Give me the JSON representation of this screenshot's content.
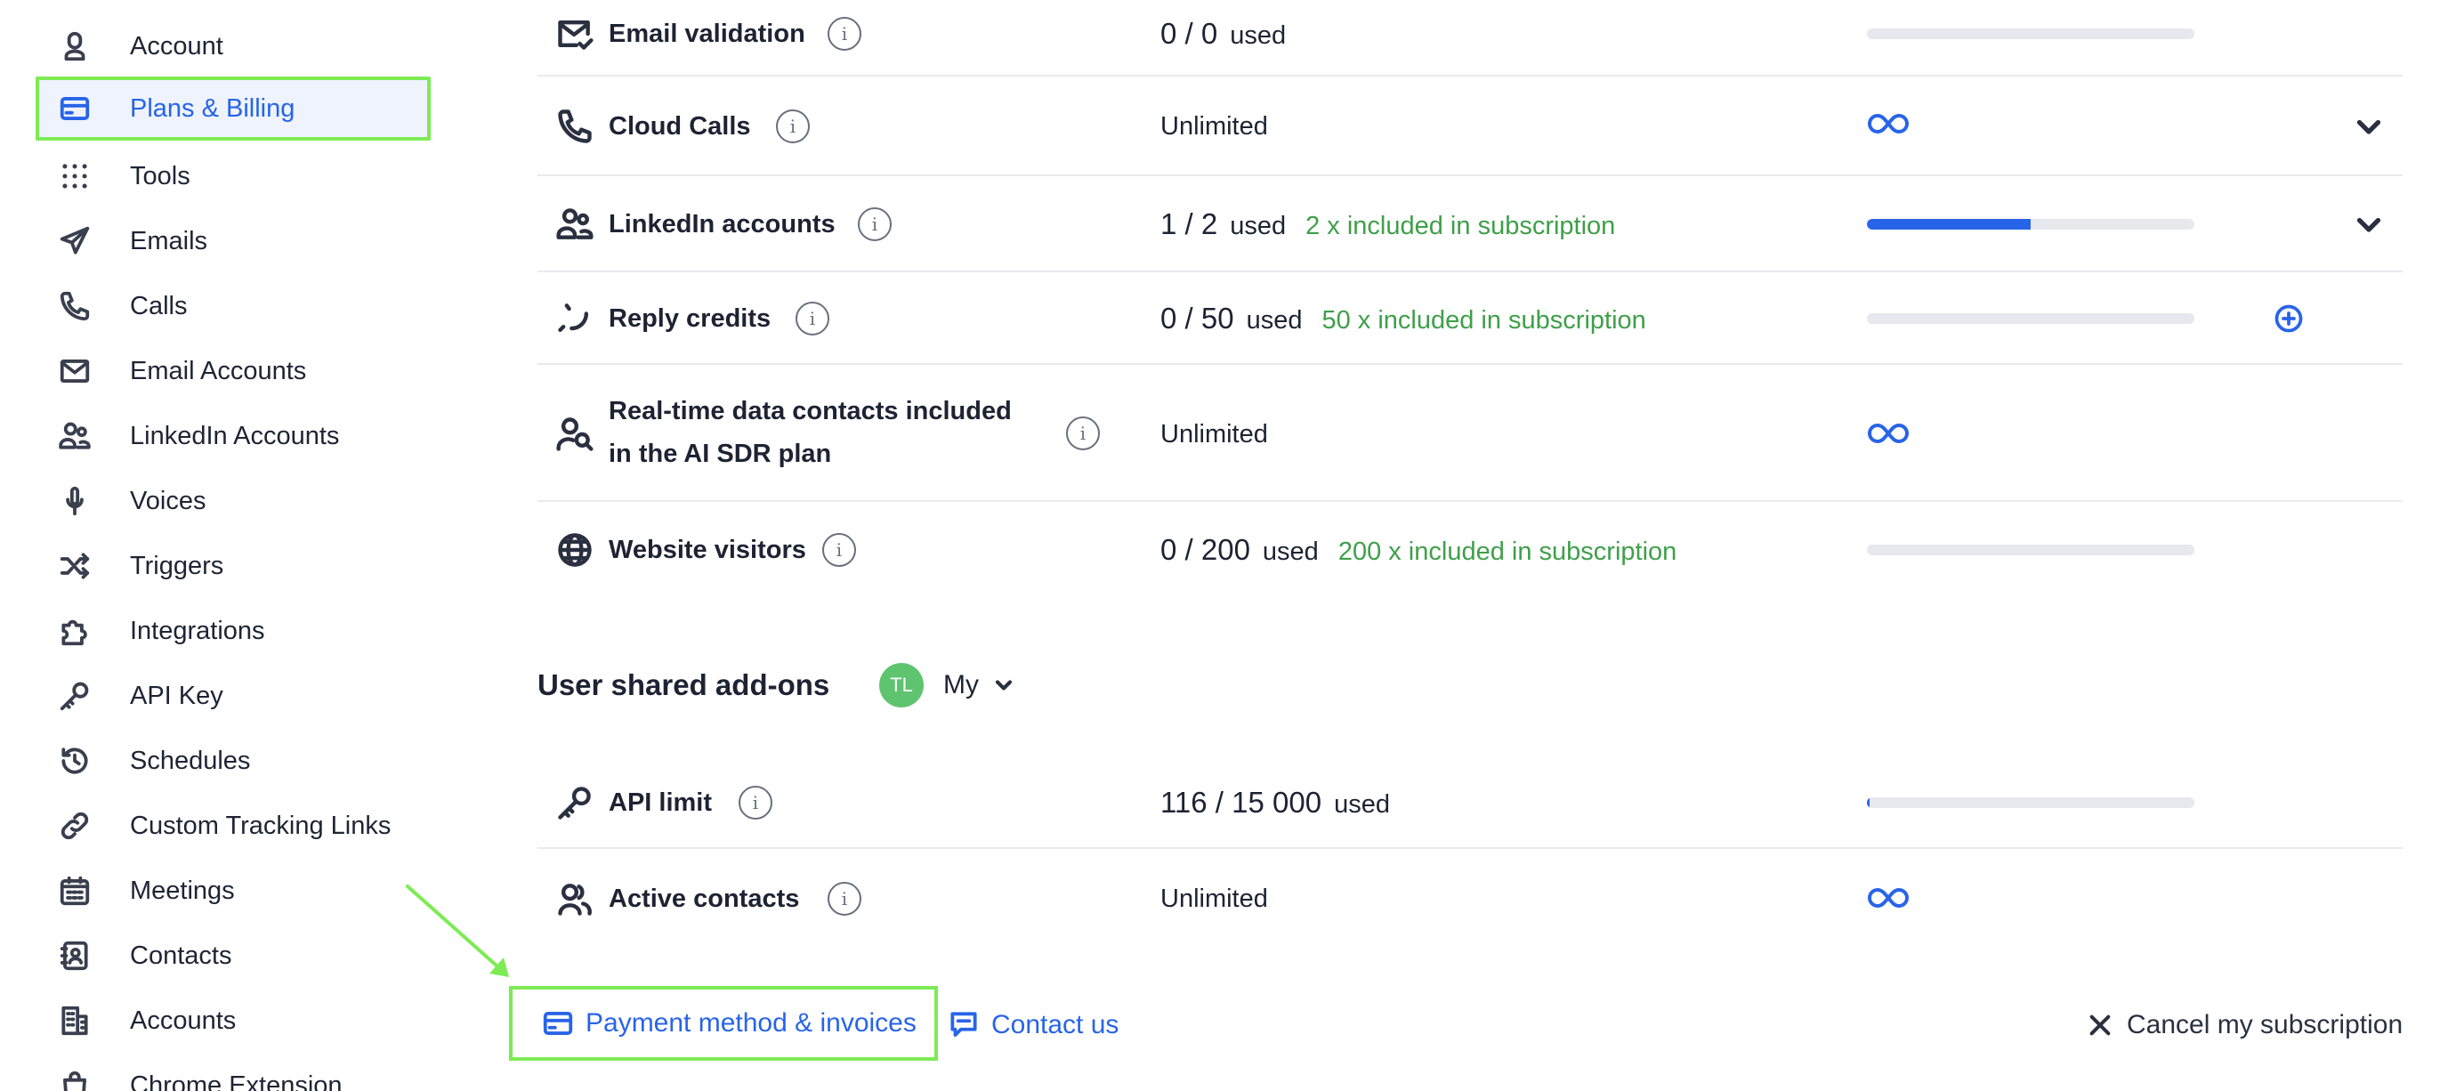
{
  "sidebar": {
    "items": [
      {
        "label": "Account",
        "icon": "user-icon"
      },
      {
        "label": "Plans & Billing",
        "icon": "credit-card-icon",
        "active": true
      },
      {
        "label": "Tools",
        "icon": "grid-dots-icon"
      },
      {
        "label": "Emails",
        "icon": "paper-plane-icon"
      },
      {
        "label": "Calls",
        "icon": "phone-icon"
      },
      {
        "label": "Email Accounts",
        "icon": "envelope-icon"
      },
      {
        "label": "LinkedIn Accounts",
        "icon": "users-icon"
      },
      {
        "label": "Voices",
        "icon": "microphone-icon"
      },
      {
        "label": "Triggers",
        "icon": "shuffle-icon"
      },
      {
        "label": "Integrations",
        "icon": "puzzle-icon"
      },
      {
        "label": "API Key",
        "icon": "key-icon"
      },
      {
        "label": "Schedules",
        "icon": "history-icon"
      },
      {
        "label": "Custom Tracking Links",
        "icon": "link-icon"
      },
      {
        "label": "Meetings",
        "icon": "calendar-icon"
      },
      {
        "label": "Contacts",
        "icon": "contact-book-icon"
      },
      {
        "label": "Accounts",
        "icon": "building-icon"
      },
      {
        "label": "Chrome Extension",
        "icon": "bag-icon"
      }
    ]
  },
  "usage_rows": [
    {
      "name": "Email validation",
      "icon": "envelope-check-icon",
      "used": "0 / 0",
      "used_label": "used",
      "progress": 0
    },
    {
      "name": "Cloud Calls",
      "icon": "phone-icon",
      "value": "Unlimited",
      "unlimited": true,
      "expandable": true
    },
    {
      "name": "LinkedIn accounts",
      "icon": "users-icon",
      "used": "1 / 2",
      "used_label": "used",
      "included": "2 x included in subscription",
      "progress": 0.5,
      "expandable": true
    },
    {
      "name": "Reply credits",
      "icon": "reply-smile-icon",
      "used": "0 / 50",
      "used_label": "used",
      "included": "50 x included in subscription",
      "progress": 0,
      "addable": true
    },
    {
      "name_line1": "Real-time data contacts included",
      "name_line2": "in the AI SDR plan",
      "icon": "user-search-icon",
      "value": "Unlimited",
      "unlimited": true
    },
    {
      "name": "Website visitors",
      "icon": "globe-icon",
      "used": "0 / 200",
      "used_label": "used",
      "included": "200 x included in subscription",
      "progress": 0
    }
  ],
  "addons": {
    "title": "User shared add-ons",
    "user": {
      "initials": "TL",
      "label": "My"
    },
    "rows": [
      {
        "name": "API limit",
        "icon": "key-icon",
        "used": "116 / 15 000",
        "used_label": "used",
        "progress": 0.008
      },
      {
        "name": "Active contacts",
        "icon": "users-icon",
        "value": "Unlimited",
        "unlimited": true
      }
    ]
  },
  "footer": {
    "payment": "Payment method & invoices",
    "contact": "Contact us",
    "cancel": "Cancel my subscription"
  },
  "colors": {
    "accent": "#2864e8",
    "included_text": "#3f9f4a",
    "highlight": "#7deb54"
  }
}
